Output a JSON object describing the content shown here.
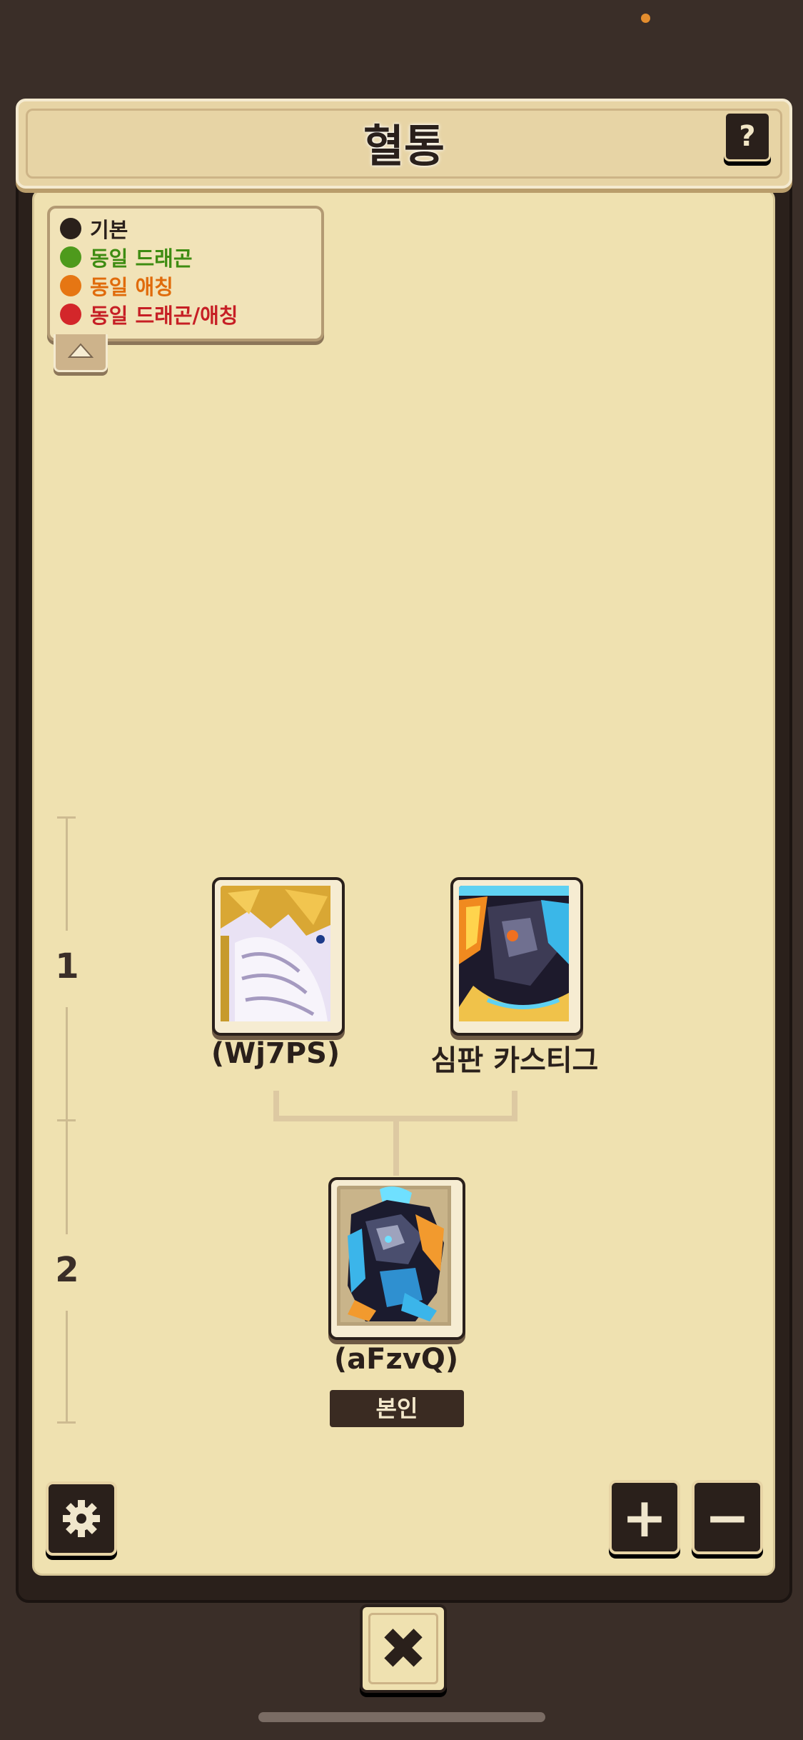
{
  "header": {
    "title": "혈통",
    "help_label": "?"
  },
  "legend": {
    "items": [
      {
        "label": "기본",
        "color": "#2a201b",
        "text_color": "#2a201b"
      },
      {
        "label": "동일 드래곤",
        "color": "#4e9a1c",
        "text_color": "#3e8c12"
      },
      {
        "label": "동일 애칭",
        "color": "#e67613",
        "text_color": "#e06b0b"
      },
      {
        "label": "동일 드래곤/애칭",
        "color": "#d3262a",
        "text_color": "#c61f25"
      }
    ],
    "collapse_icon": "chevron-up-icon"
  },
  "generations": [
    "1",
    "2"
  ],
  "tree": {
    "parents": [
      {
        "name": "(Wj7PS)",
        "icon": "white-gold-dragon-portrait"
      },
      {
        "name": "심판 카스티그",
        "icon": "dark-blue-dragon-portrait"
      }
    ],
    "self": {
      "name": "(aFzvQ)",
      "badge": "본인",
      "icon": "armored-blue-dragon-portrait"
    }
  },
  "controls": {
    "settings_icon": "gear-icon",
    "zoom_in_label": "+",
    "zoom_out_label": "−",
    "close_label": "✖"
  },
  "colors": {
    "background": "#3a2e28",
    "panel": "#efe1b0",
    "accent_dark": "#2a201b"
  }
}
